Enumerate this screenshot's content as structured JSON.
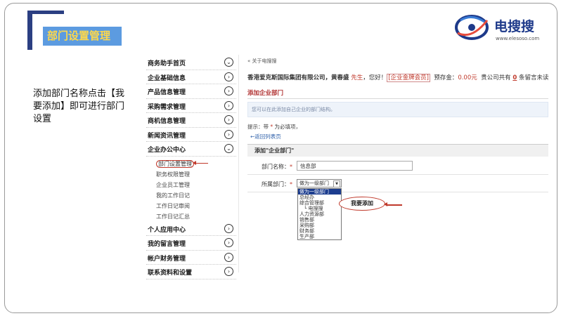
{
  "slide": {
    "title": "部门设置管理",
    "logo_name": "电搜搜",
    "logo_url": "www.elesoso.com",
    "instruction": "添加部门名称点击【我要添加】即可进行部门设置"
  },
  "sidebar": {
    "items": [
      {
        "label": "商务助手首页"
      },
      {
        "label": "企业基础信息"
      },
      {
        "label": "产品信息管理"
      },
      {
        "label": "采购需求管理"
      },
      {
        "label": "商机信息管理"
      },
      {
        "label": "新闻资讯管理"
      },
      {
        "label": "企业办公中心"
      }
    ],
    "subitems": [
      {
        "label": "部门设置管理"
      },
      {
        "label": "职务权限管理"
      },
      {
        "label": "企业员工管理"
      },
      {
        "label": "我的工作日记"
      },
      {
        "label": "工作日记审阅"
      },
      {
        "label": "工作日记汇总"
      }
    ],
    "items2": [
      {
        "label": "个人应用中心"
      },
      {
        "label": "我的留言管理"
      },
      {
        "label": "帐户财务管理"
      },
      {
        "label": "联系资料和设置"
      }
    ]
  },
  "main": {
    "breadcrumb": "« 关于电搜搜",
    "company": "香港爱克斯国际集团有限公司，黄春盛",
    "title_suffix": "先生",
    "greeting": "，您好！",
    "member": "[企业金牌会员]",
    "deposit_label": "预存金：",
    "deposit_value": "0.00元",
    "messages_prefix": "贵公司共有",
    "messages_count": "0",
    "messages_suffix": "条留言未读",
    "section_title": "添加企业部门",
    "notice": "您可以在此添加自己企业的部门结构。",
    "tip_prefix": "提示：带",
    "tip_star": "*",
    "tip_suffix": "为必填项，",
    "back_link": "←返回列表页",
    "form_title": "添加\"企业部门\"",
    "name_label": "部门名称：",
    "name_value": "信息部",
    "parent_label": "所属部门：",
    "required_star": "*",
    "parent_selected": "做为一级部门",
    "parent_options": [
      "做为一级部门",
      "总经办",
      "综合管理部",
      "└ 电搜搜",
      "人力资源部",
      "销售部",
      "采购部",
      "财务部",
      "生产部"
    ],
    "submit_label": "我要添加"
  },
  "colors": {
    "title_bar": "#5c9be0",
    "title_text": "#ffd84a",
    "bracket": "#2b3f82",
    "accent_red": "#c0392b",
    "selected": "#1c3d8f"
  }
}
